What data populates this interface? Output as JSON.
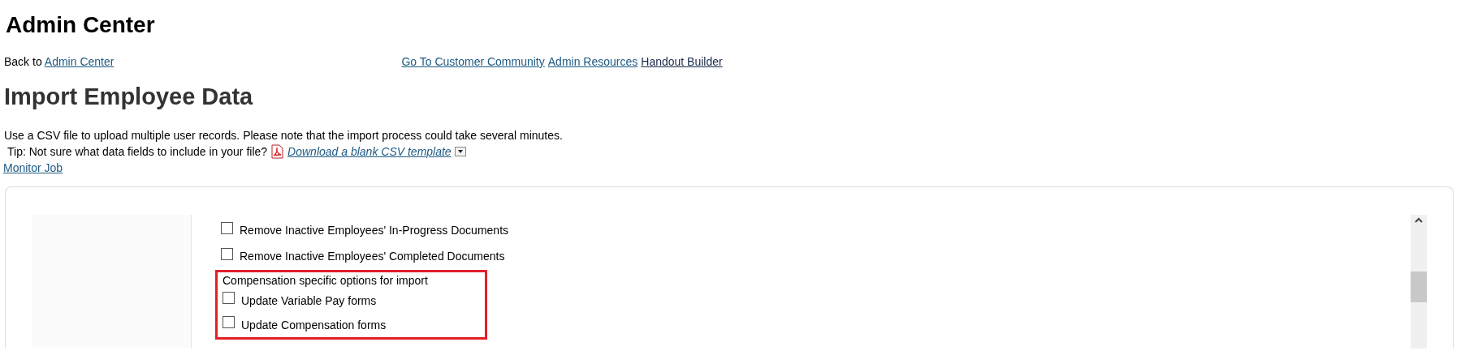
{
  "app_title": "Admin Center",
  "back_link": {
    "prefix": "Back to",
    "link": "Admin Center"
  },
  "top_links": [
    {
      "label": "Go To Customer Community",
      "visited": false
    },
    {
      "label": "Admin Resources",
      "visited": false
    },
    {
      "label": "Handout Builder",
      "visited": true
    }
  ],
  "page_title": "Import Employee Data",
  "description": "Use a CSV file to upload multiple user records. Please note that the import process could take several minutes.",
  "tip": {
    "text": "Tip: Not sure what data fields to include in your file?",
    "link": "Download a blank CSV template"
  },
  "monitor_link": "Monitor Job",
  "options": [
    {
      "kind": "checkbox",
      "label": "Remove Inactive Employees' In-Progress Documents",
      "checked": false
    },
    {
      "kind": "checkbox",
      "label": "Remove Inactive Employees' Completed Documents",
      "checked": false
    }
  ],
  "compensation_section": {
    "title": "Compensation specific options for import",
    "highlighted": true,
    "options": [
      {
        "kind": "checkbox",
        "label": "Update Variable Pay forms",
        "checked": false
      },
      {
        "kind": "checkbox",
        "label": "Update Compensation forms",
        "checked": false
      }
    ]
  }
}
